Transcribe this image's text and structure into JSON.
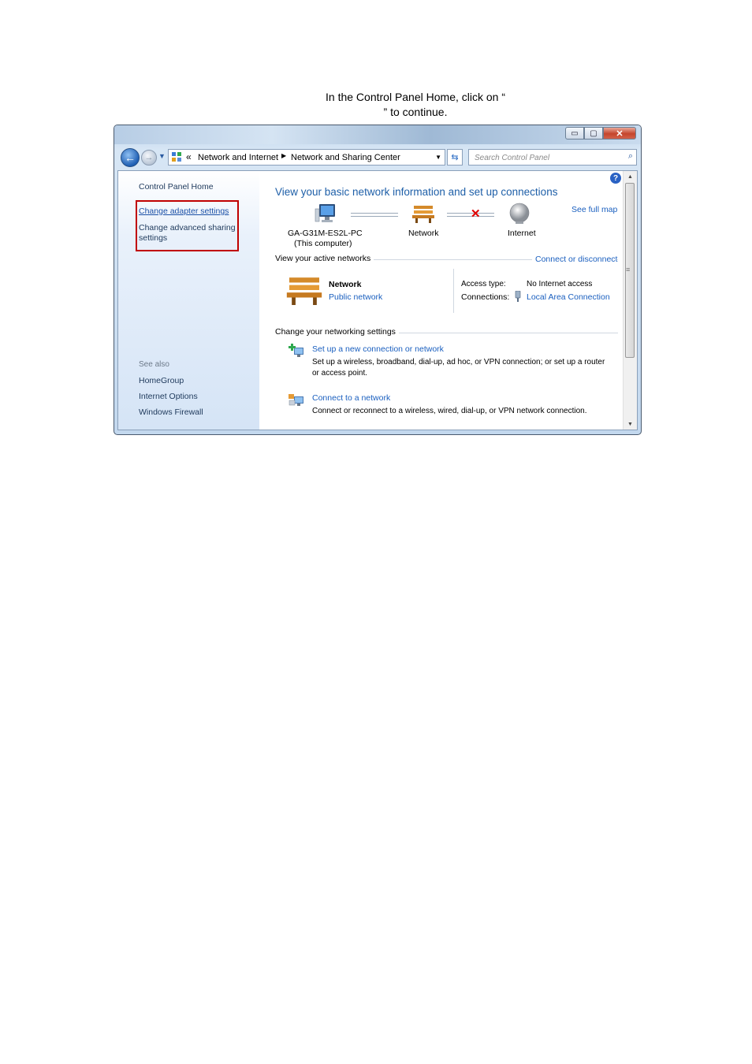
{
  "instruction": {
    "line1": "In the Control Panel Home, click on “",
    "line2": "” to continue."
  },
  "window": {
    "controls": {
      "minimize": "▭",
      "maximize": "▢",
      "close": "✕"
    }
  },
  "nav": {
    "chevron": "«",
    "breadcrumbs": [
      "Network and Internet",
      "Network and Sharing Center"
    ],
    "search_placeholder": "Search Control Panel"
  },
  "sidebar": {
    "home": "Control Panel Home",
    "links": [
      "Change adapter settings",
      "Change advanced sharing",
      "settings"
    ],
    "see_also_title": "See also",
    "see_also": [
      "HomeGroup",
      "Internet Options",
      "Windows Firewall"
    ]
  },
  "main": {
    "title": "View your basic network information and set up connections",
    "see_full_map": "See full map",
    "map": {
      "computer_name": "GA-G31M-ES2L-PC",
      "computer_sub": "(This computer)",
      "network": "Network",
      "internet": "Internet"
    },
    "active": {
      "label": "View your active networks",
      "connect_link": "Connect or disconnect",
      "network_name": "Network",
      "network_type": "Public network",
      "access_type_label": "Access type:",
      "access_type_value": "No Internet access",
      "connections_label": "Connections:",
      "connections_value": "Local Area Connection"
    },
    "change": {
      "label": "Change your networking settings",
      "items": [
        {
          "title": "Set up a new connection or network",
          "desc1": "Set up a wireless, broadband, dial-up, ad hoc, or VPN connection; or set up a router",
          "desc2": "or access point."
        },
        {
          "title": "Connect to a network",
          "desc1": "Connect or reconnect to a wireless, wired, dial-up, or VPN network connection."
        }
      ]
    }
  },
  "colors": {
    "link": "#1a5fbf",
    "heading": "#1e5fa8",
    "highlight": "#c00000",
    "error": "#e00000"
  }
}
